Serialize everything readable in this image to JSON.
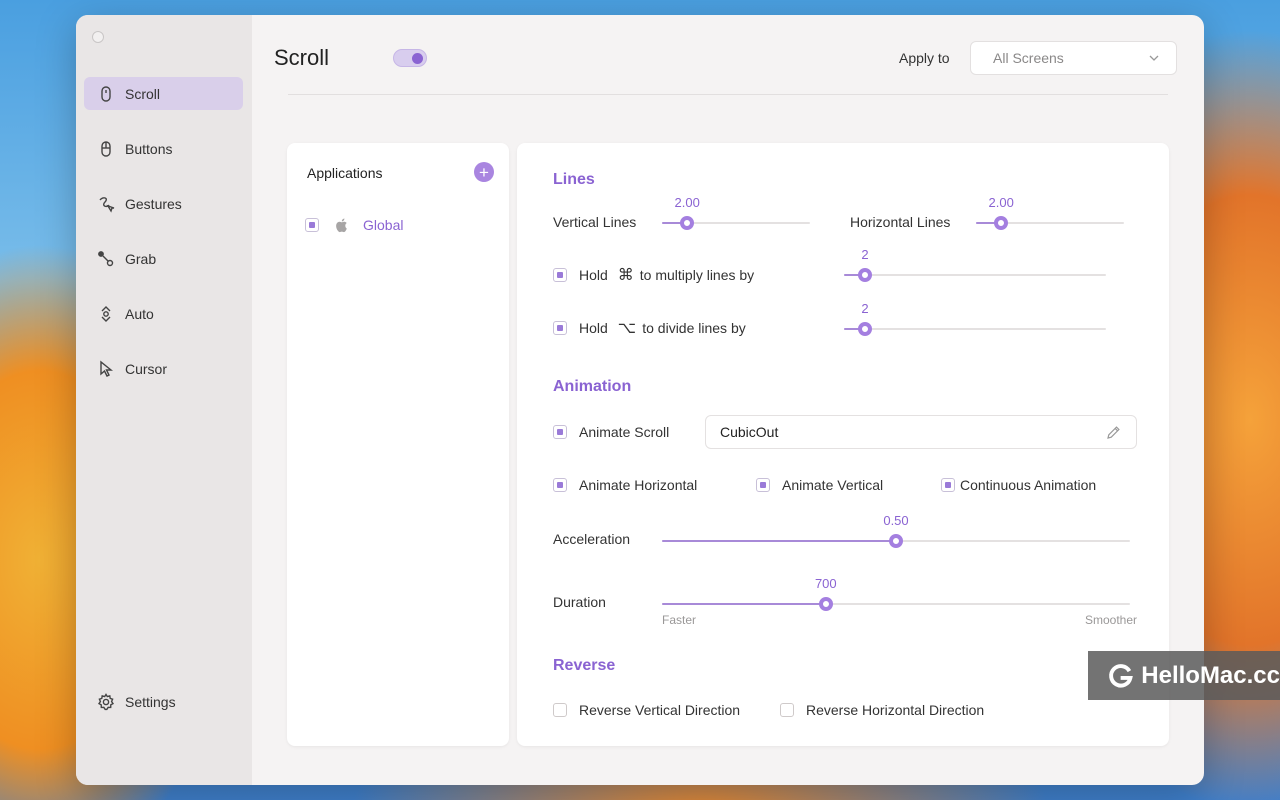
{
  "sidebar": {
    "items": [
      {
        "label": "Scroll",
        "icon": "mouse-icon",
        "active": true
      },
      {
        "label": "Buttons",
        "icon": "mouse-buttons-icon",
        "active": false
      },
      {
        "label": "Gestures",
        "icon": "gesture-icon",
        "active": false
      },
      {
        "label": "Grab",
        "icon": "grab-icon",
        "active": false
      },
      {
        "label": "Auto",
        "icon": "auto-scroll-icon",
        "active": false
      },
      {
        "label": "Cursor",
        "icon": "cursor-icon",
        "active": false
      }
    ],
    "settings_label": "Settings"
  },
  "header": {
    "title": "Scroll",
    "enabled": true,
    "apply_label": "Apply to",
    "apply_value": "All Screens"
  },
  "apps": {
    "title": "Applications",
    "add_label": "+",
    "items": [
      {
        "name": "Global",
        "checked": true
      }
    ]
  },
  "lines": {
    "title": "Lines",
    "vertical_label": "Vertical Lines",
    "vertical_value": "2.00",
    "vertical_fraction": 0.17,
    "horizontal_label": "Horizontal Lines",
    "horizontal_value": "2.00",
    "horizontal_fraction": 0.17,
    "multiply": {
      "pre": "Hold",
      "key": "⌘",
      "post": "to multiply lines by",
      "value": "2",
      "fraction": 0.08,
      "checked": true
    },
    "divide": {
      "pre": "Hold",
      "key": "⌥",
      "post": "to divide lines by",
      "value": "2",
      "fraction": 0.08,
      "checked": true
    }
  },
  "animation": {
    "title": "Animation",
    "animate_scroll_label": "Animate Scroll",
    "easing_value": "CubicOut",
    "animate_horizontal_label": "Animate Horizontal",
    "animate_vertical_label": "Animate Vertical",
    "continuous_label": "Continuous Animation",
    "acceleration_label": "Acceleration",
    "acceleration_value": "0.50",
    "acceleration_fraction": 0.5,
    "duration_label": "Duration",
    "duration_value": "700",
    "duration_fraction": 0.35,
    "faster_label": "Faster",
    "smoother_label": "Smoother"
  },
  "reverse": {
    "title": "Reverse",
    "vertical_label": "Reverse Vertical Direction",
    "horizontal_label": "Reverse Horizontal Direction"
  },
  "watermark": {
    "text": "HelloMac.cc"
  },
  "colors": {
    "accent": "#8a63d2",
    "accent_light": "#d9cfea"
  }
}
